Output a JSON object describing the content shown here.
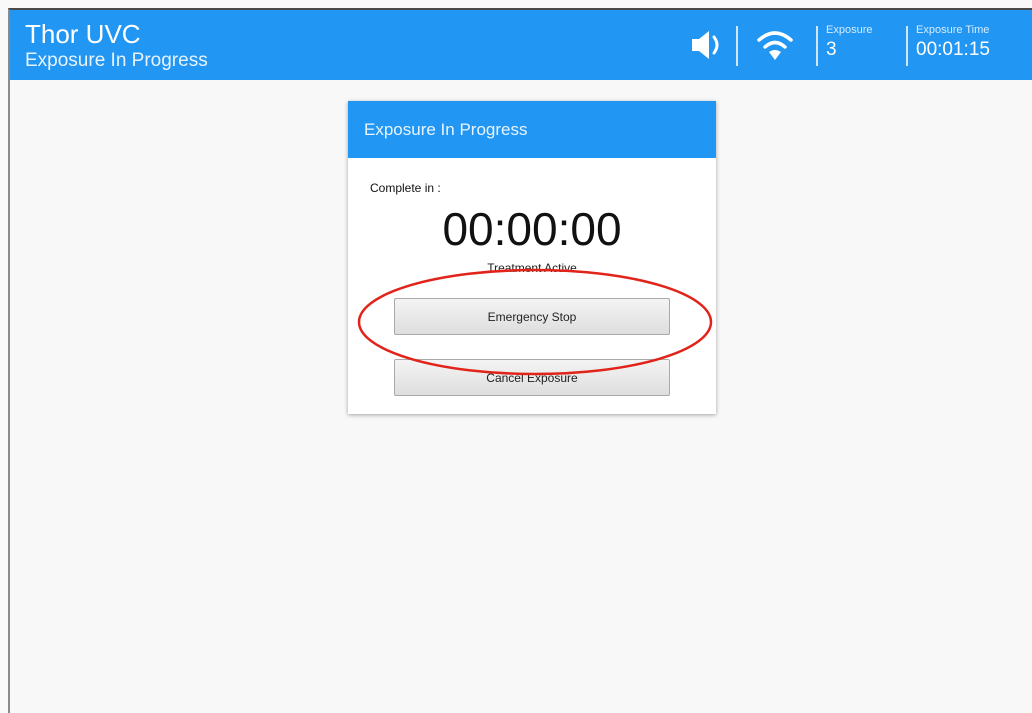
{
  "header": {
    "app_title": "Thor UVC",
    "subtitle": "Exposure In Progress",
    "exposure_label": "Exposure",
    "exposure_value": "3",
    "exposure_time_label": "Exposure Time",
    "exposure_time_value": "00:01:15",
    "icons": [
      "speaker-icon",
      "wifi-icon"
    ]
  },
  "dialog": {
    "title": "Exposure In Progress",
    "complete_label": "Complete in :",
    "countdown": "00:00:00",
    "status": "Treatment Active",
    "emergency_stop_label": "Emergency Stop",
    "cancel_label": "Cancel Exposure"
  },
  "colors": {
    "header_blue": "#2196f3",
    "highlight_red": "#e2231a"
  }
}
